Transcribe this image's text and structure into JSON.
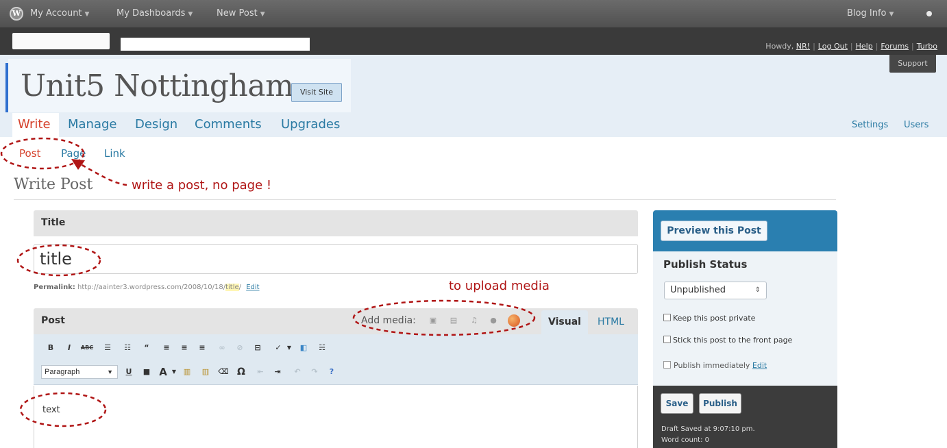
{
  "admin_bar": {
    "menus": [
      "My Account",
      "My Dashboards",
      "New Post"
    ],
    "blog_info": "Blog Info",
    "logo_icon": "wordpress-logo-icon"
  },
  "user_links": {
    "howdy": "Howdy,",
    "user": "NR!",
    "links": [
      "Log Out",
      "Help",
      "Forums",
      "Turbo"
    ],
    "support": "Support"
  },
  "site": {
    "title": "Unit5 Nottingham",
    "visit_site": "Visit Site"
  },
  "main_tabs": [
    "Write",
    "Manage",
    "Design",
    "Comments",
    "Upgrades"
  ],
  "right_tabs": [
    "Settings",
    "Users"
  ],
  "sub_tabs": [
    "Post",
    "Page",
    "Link"
  ],
  "page_heading": "Write Post",
  "annotations": {
    "write_post": "write a post, no page !",
    "upload_media": "to upload media",
    "color": "#b01515"
  },
  "title_box": {
    "label": "Title",
    "value": "title",
    "permalink_label": "Permalink:",
    "permalink_url": "http://aainter3.wordpress.com/2008/10/18/",
    "permalink_slug": "title",
    "permalink_end": "/",
    "permalink_edit": "Edit"
  },
  "post_box": {
    "label": "Post",
    "add_media": "Add media:",
    "media_icons": [
      "image-icon",
      "video-icon",
      "audio-icon",
      "media-icon",
      "flash-icon"
    ],
    "tab_visual": "Visual",
    "tab_html": "HTML",
    "format_value": "Paragraph",
    "content": "text"
  },
  "sidebar": {
    "preview": "Preview this Post",
    "status_title": "Publish Status",
    "status_value": "Unpublished",
    "keep_private": "Keep this post private",
    "stick_front": "Stick this post to the front page",
    "publish_immediately": "Publish immediately",
    "publish_edit": "Edit",
    "save": "Save",
    "publish": "Publish",
    "draft_saved": "Draft Saved at 9:07:10 pm.",
    "word_count": "Word count: 0"
  },
  "colors": {
    "accent_blue": "#2a7aa3",
    "active_tab": "#d5402b",
    "sidebar_top": "#2a7fb0"
  }
}
